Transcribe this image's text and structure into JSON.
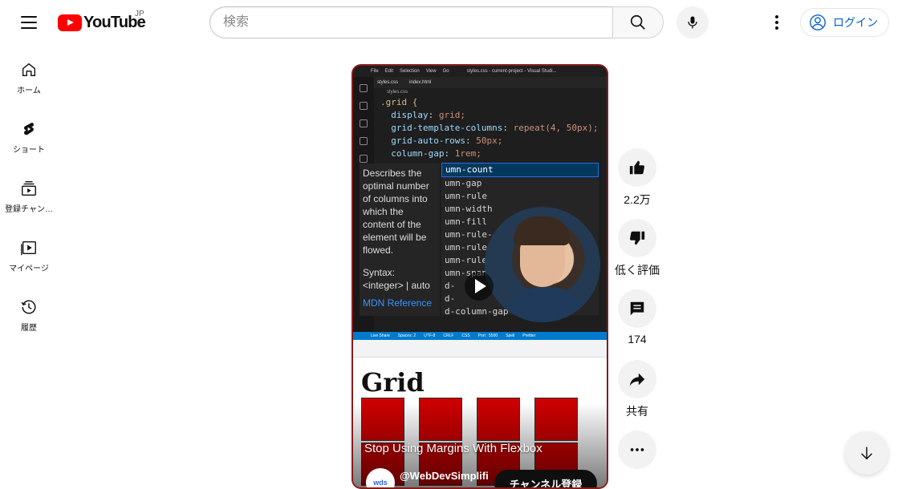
{
  "header": {
    "logo_text": "YouTube",
    "region": "JP",
    "search_placeholder": "検索",
    "login_label": "ログイン"
  },
  "sidebar": {
    "items": [
      {
        "label": "ホーム",
        "icon": "home-icon"
      },
      {
        "label": "ショート",
        "icon": "shorts-icon"
      },
      {
        "label": "登録チャン…",
        "icon": "subscriptions-icon"
      },
      {
        "label": "マイページ",
        "icon": "library-icon"
      },
      {
        "label": "履歴",
        "icon": "history-icon"
      }
    ]
  },
  "video": {
    "title": "Stop Using Margins With Flexbox",
    "channel": "@WebDevSimplifi",
    "channel_avatar_text": "wds",
    "subscribe_label": "チャンネル登録",
    "editor": {
      "menu": [
        "File",
        "Edit",
        "Selection",
        "View",
        "Go"
      ],
      "window_title": "styles.css - current-project - Visual Studi...",
      "tabs": [
        "styles.css",
        "index.html"
      ],
      "breadcrumb": "styles.css",
      "code_lines": [
        {
          "sel": ".grid {"
        },
        {
          "prop": "  display",
          "val": "grid;"
        },
        {
          "prop": "  grid-template-columns",
          "val": "repeat(4, 50px);"
        },
        {
          "prop": "  grid-auto-rows",
          "val": "50px;"
        },
        {
          "prop": "  column-gap",
          "val": "1rem;"
        }
      ],
      "doc_text": "Describes the optimal number of columns into which the content of the element will be flowed.",
      "doc_syntax": "Syntax: <integer> | auto",
      "doc_ref": "MDN Reference",
      "suggestions": [
        "umn-count",
        "umn-gap",
        "umn-rule",
        "umn-width",
        "umn-fill",
        "umn-rule-",
        "umn-rule-",
        "umn-rule-",
        "umn-span",
        "d-",
        "d-",
        "d-column-gap"
      ],
      "status": [
        "Live Share",
        "Spaces: 2",
        "UTF-8",
        "CRLF",
        "CSS",
        "Port : 5500",
        "Spell",
        "Prettier"
      ]
    },
    "page_heading": "Grid"
  },
  "actions": {
    "like_count": "2.2万",
    "dislike_label": "低く評価",
    "comments_count": "174",
    "share_label": "共有"
  },
  "colors": {
    "brand_red": "#ff0000",
    "link_blue": "#065fd4",
    "grid_red": "#cc0000"
  }
}
